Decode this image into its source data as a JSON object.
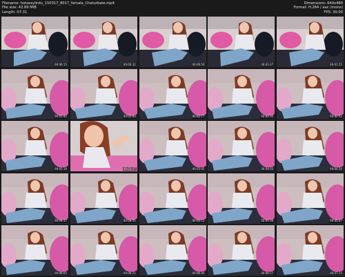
{
  "header": {
    "left": [
      "Filename: hotsexylinks_150317_8017_female_Chaturbate.mp4",
      "File size: 42.89 MiB",
      "Length: 07:31"
    ],
    "right": [
      "Dimensions: 640x480",
      "Format: H.264 / aac (mono)",
      "FPS: 30.00"
    ]
  },
  "colors": {
    "background": "#1a1a1a",
    "header_text": "#e6e6e6",
    "pillow_pink": "#d65aa7",
    "wall": "#cdbfbf",
    "jeans": "#7fa6c9"
  },
  "thumbnails": [
    {
      "scene": "couch",
      "ts": "00:00:15"
    },
    {
      "scene": "couch",
      "ts": "00:00:32"
    },
    {
      "scene": "couch",
      "ts": "00:00:50"
    },
    {
      "scene": "couch",
      "ts": "00:01:07"
    },
    {
      "scene": "couch",
      "ts": "00:01:25"
    },
    {
      "scene": "pink",
      "ts": "00:01:42"
    },
    {
      "scene": "pink",
      "ts": "00:02:00"
    },
    {
      "scene": "pink",
      "ts": "00:02:17"
    },
    {
      "scene": "pink",
      "ts": "00:02:35"
    },
    {
      "scene": "pink",
      "ts": "00:02:52"
    },
    {
      "scene": "pink",
      "ts": "00:03:10"
    },
    {
      "scene": "closeup",
      "ts": "00:03:27"
    },
    {
      "scene": "pink",
      "ts": "00:03:45"
    },
    {
      "scene": "pink",
      "ts": "00:04:02"
    },
    {
      "scene": "pink",
      "ts": "00:04:20"
    },
    {
      "scene": "pink",
      "ts": "00:04:37"
    },
    {
      "scene": "pink",
      "ts": "00:04:55"
    },
    {
      "scene": "pink",
      "ts": "00:05:12"
    },
    {
      "scene": "pink",
      "ts": "00:05:30"
    },
    {
      "scene": "pink",
      "ts": "00:05:47"
    },
    {
      "scene": "pink",
      "ts": "00:06:05"
    },
    {
      "scene": "pink",
      "ts": "00:06:22"
    },
    {
      "scene": "pink",
      "ts": "00:06:40"
    },
    {
      "scene": "pink",
      "ts": "00:06:57"
    },
    {
      "scene": "pink",
      "ts": "00:07:15"
    }
  ]
}
